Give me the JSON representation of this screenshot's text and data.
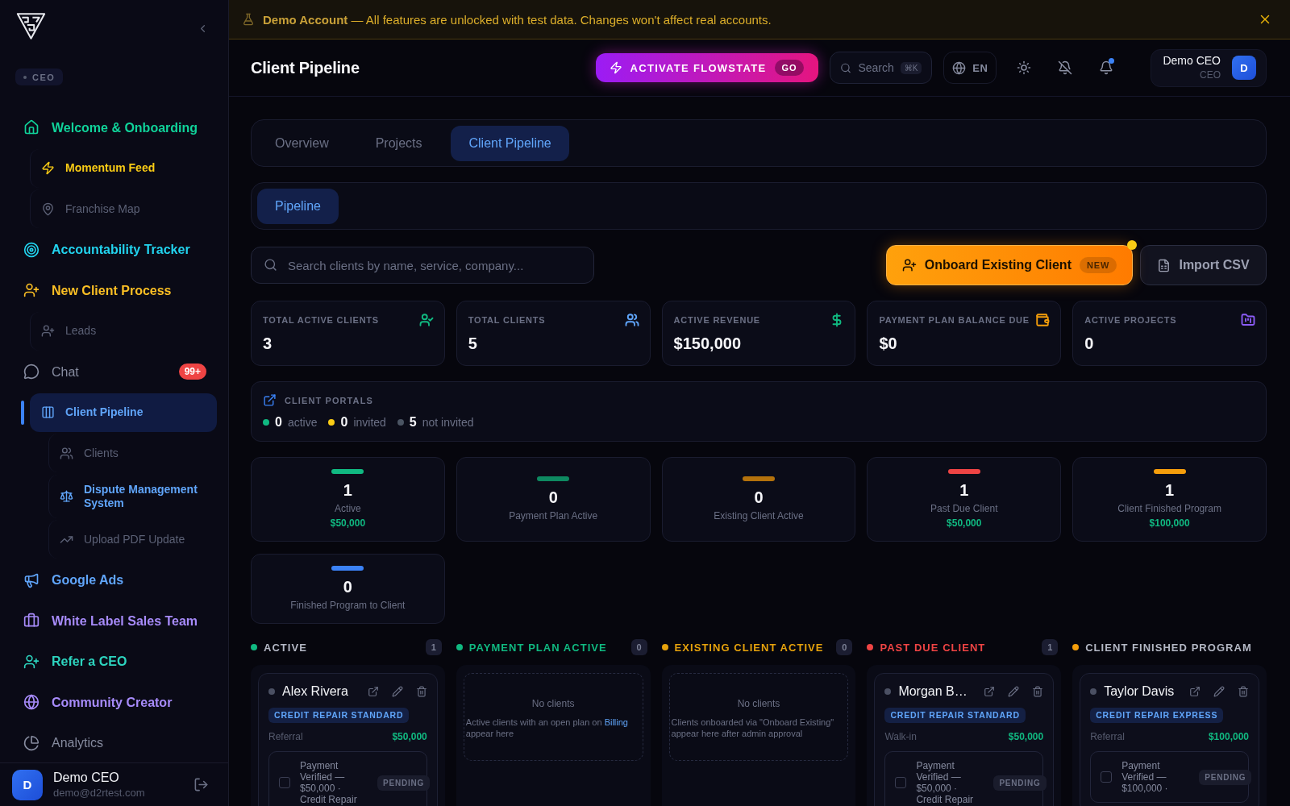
{
  "banner": {
    "text": "**Demo Account** — All features are unlocked with test data. Changes won't affect real accounts."
  },
  "sidebar": {
    "role": "CEO",
    "items": [
      {
        "label": "Welcome & Onboarding",
        "highlighted": true,
        "color": "#10d39a",
        "selected": false,
        "children": [
          {
            "label": "Momentum Feed",
            "highlighted": true,
            "color": "#facc15",
            "selected": false
          },
          {
            "label": "Franchise Map",
            "highlighted": false,
            "selected": false
          }
        ]
      },
      {
        "label": "Accountability Tracker",
        "highlighted": true,
        "color": "#22d3ee",
        "selected": false
      },
      {
        "label": "New Client Process",
        "highlighted": true,
        "color": "#fbbf24",
        "selected": false,
        "children": [
          {
            "label": "Leads",
            "highlighted": false,
            "selected": false
          }
        ]
      },
      {
        "label": "Chat",
        "highlighted": false,
        "selected": false,
        "badge": "99+",
        "children": [
          {
            "label": "Client Pipeline",
            "highlighted": true,
            "color": "#60a5fa",
            "selected": true,
            "children": [
              {
                "label": "Clients",
                "highlighted": false,
                "selected": false
              },
              {
                "label": "Dispute Management System",
                "highlighted": true,
                "color": "#60a5fa",
                "selected": false
              },
              {
                "label": "Upload PDF Update",
                "highlighted": false,
                "selected": false
              }
            ]
          }
        ]
      },
      {
        "label": "Google Ads",
        "highlighted": true,
        "color": "#60a5fa",
        "selected": false
      },
      {
        "label": "White Label Sales Team",
        "highlighted": true,
        "color": "#a78bfa",
        "selected": false
      },
      {
        "label": "Refer a CEO",
        "highlighted": true,
        "color": "#2dd4bf",
        "selected": false
      },
      {
        "label": "Community Creator",
        "highlighted": true,
        "color": "#a78bfa",
        "selected": false
      },
      {
        "label": "Analytics",
        "highlighted": false,
        "selected": false
      }
    ],
    "user": {
      "initial": "D",
      "name": "Demo CEO",
      "email": "demo@d2rtest.com"
    }
  },
  "header": {
    "title": "Client Pipeline",
    "flowstate": {
      "label": "ACTIVATE FLOWSTATE",
      "tag": "GO"
    },
    "search": {
      "label": "Search",
      "shortcut": "⌘K"
    },
    "language": "EN",
    "notifications": {
      "unread": true
    },
    "user": {
      "name": "Demo CEO",
      "role": "CEO",
      "initial": "D"
    }
  },
  "tabs": [
    {
      "label": "Overview",
      "selected": false
    },
    {
      "label": "Projects",
      "selected": false
    },
    {
      "label": "Client Pipeline",
      "selected": true
    }
  ],
  "subtabs": [
    {
      "label": "Pipeline",
      "selected": true
    }
  ],
  "toolbar": {
    "search": {
      "placeholder": "Search clients by name, service, company..."
    },
    "onboard": {
      "label": "Onboard Existing Client",
      "tag": "NEW",
      "attention": true
    },
    "import": {
      "label": "Import CSV"
    }
  },
  "stats": [
    {
      "label": "TOTAL ACTIVE CLIENTS",
      "value": "3",
      "color": "#10b981"
    },
    {
      "label": "TOTAL CLIENTS",
      "value": "5",
      "color": "#60a5fa"
    },
    {
      "label": "ACTIVE REVENUE",
      "value": "$150,000",
      "color": "#10b981"
    },
    {
      "label": "PAYMENT PLAN BALANCE DUE",
      "value": "$0",
      "color": "#f59e0b"
    },
    {
      "label": "ACTIVE PROJECTS",
      "value": "0",
      "color": "#8b5cf6"
    }
  ],
  "portals": {
    "title": "CLIENT PORTALS",
    "counts": [
      {
        "value": "0",
        "label": "active",
        "color": "#10b981"
      },
      {
        "value": "0",
        "label": "invited",
        "color": "#facc15"
      },
      {
        "value": "5",
        "label": "not invited",
        "color": "#4b5563"
      }
    ]
  },
  "stages": [
    {
      "count": "1",
      "label": "Active",
      "amount": "$50,000",
      "color": "#10b981"
    },
    {
      "count": "0",
      "label": "Payment Plan Active",
      "color": "#0e8a61"
    },
    {
      "count": "0",
      "label": "Existing Client Active",
      "color": "#b4720c"
    },
    {
      "count": "1",
      "label": "Past Due Client",
      "amount": "$50,000",
      "color": "#ef4444"
    },
    {
      "count": "1",
      "label": "Client Finished Program",
      "amount": "$100,000",
      "color": "#f59e0b"
    },
    {
      "count": "0",
      "label": "Finished Program to Client",
      "color": "#3b82f6"
    }
  ],
  "columns": [
    {
      "title": "ACTIVE",
      "tinted": false,
      "color": "#10b981",
      "count": "1",
      "clients": [
        {
          "name": "Alex Rivera",
          "service": "CREDIT REPAIR STANDARD",
          "source": "Referral",
          "amount": "$50,000",
          "task": {
            "text": "Payment Verified — $50,000 · Credit Repair",
            "status": "PENDING",
            "checked": false
          }
        }
      ]
    },
    {
      "title": "PAYMENT PLAN ACTIVE",
      "tinted": true,
      "color": "#10b981",
      "count": "0",
      "empty": {
        "title": "No clients",
        "text": "Active clients with an open plan on",
        "link": "Billing",
        "text_end": "appear here"
      }
    },
    {
      "title": "EXISTING CLIENT ACTIVE",
      "tinted": true,
      "color": "#e6a20c",
      "count": "0",
      "empty": {
        "title": "No clients",
        "text": "Clients onboarded via \"Onboard Existing\" appear here after admin approval"
      }
    },
    {
      "title": "PAST DUE CLIENT",
      "tinted": true,
      "color": "#ef4444",
      "count": "1",
      "clients": [
        {
          "name": "Morgan B…",
          "service": "CREDIT REPAIR STANDARD",
          "source": "Walk-in",
          "amount": "$50,000",
          "task": {
            "text": "Payment Verified — $50,000 · Credit Repair",
            "status": "PENDING",
            "checked": false
          }
        }
      ]
    },
    {
      "title": "CLIENT FINISHED PROGRAM",
      "tinted": false,
      "color": "#f59e0b",
      "clients": [
        {
          "name": "Taylor Davis",
          "service": "CREDIT REPAIR EXPRESS",
          "source": "Referral",
          "amount": "$100,000",
          "task": {
            "text": "Payment Verified — $100,000 ·",
            "status": "PENDING",
            "checked": false
          }
        }
      ]
    }
  ]
}
